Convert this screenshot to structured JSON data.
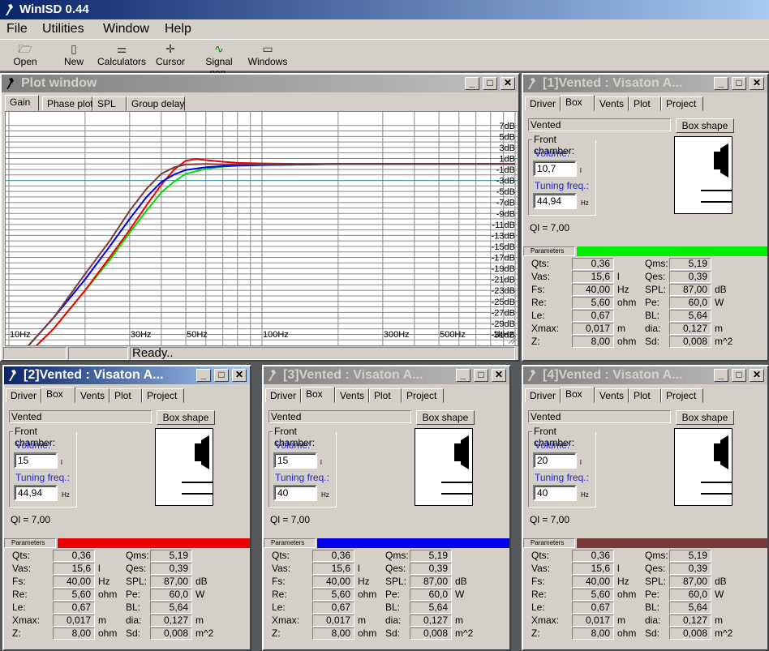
{
  "app": {
    "title": "WinISD 0.44"
  },
  "menu": [
    "File",
    "Utilities",
    "Window",
    "Help"
  ],
  "toolbar": [
    {
      "label": "Open",
      "icon": "open-folder-icon"
    },
    {
      "label": "New",
      "icon": "new-document-icon"
    },
    {
      "label": "Calculators",
      "icon": "calculator-icon"
    },
    {
      "label": "Cursor",
      "icon": "crosshair-cursor-icon"
    },
    {
      "label": "Signal gen.",
      "icon": "signal-generator-icon"
    },
    {
      "label": "Windows",
      "icon": "windows-icon"
    }
  ],
  "plot": {
    "title": "Plot window",
    "tabs": [
      "Gain",
      "Phase plot",
      "SPL",
      "Group delay"
    ],
    "status": "Ready..",
    "chart_data": {
      "type": "line",
      "x_scale": "log",
      "xlim": [
        10,
        1000
      ],
      "ylim": [
        -33,
        8
      ],
      "x_ticks": [
        {
          "v": 10,
          "t": "10Hz"
        },
        {
          "v": 30,
          "t": "30Hz"
        },
        {
          "v": 50,
          "t": "50Hz"
        },
        {
          "v": 100,
          "t": "100Hz"
        },
        {
          "v": 300,
          "t": "300Hz"
        },
        {
          "v": 500,
          "t": "500Hz"
        },
        {
          "v": 1000,
          "t": "1kHz"
        }
      ],
      "y_ticks": [
        {
          "v": 7,
          "t": "7dB"
        },
        {
          "v": 5,
          "t": "5dB"
        },
        {
          "v": 3,
          "t": "3dB"
        },
        {
          "v": 1,
          "t": "1dB"
        },
        {
          "v": -1,
          "t": "-1dB"
        },
        {
          "v": -3,
          "t": "-3dB"
        },
        {
          "v": -5,
          "t": "-5dB"
        },
        {
          "v": -7,
          "t": "-7dB"
        },
        {
          "v": -9,
          "t": "-9dB"
        },
        {
          "v": -11,
          "t": "-11dB"
        },
        {
          "v": -13,
          "t": "-13dB"
        },
        {
          "v": -15,
          "t": "-15dB"
        },
        {
          "v": -17,
          "t": "-17dB"
        },
        {
          "v": -19,
          "t": "-19dB"
        },
        {
          "v": -21,
          "t": "-21dB"
        },
        {
          "v": -23,
          "t": "-23dB"
        },
        {
          "v": -25,
          "t": "-25dB"
        },
        {
          "v": -27,
          "t": "-27dB"
        },
        {
          "v": -29,
          "t": "-29dB"
        },
        {
          "v": -31,
          "t": "-31dB"
        }
      ],
      "series": [
        {
          "color": "#00dd00",
          "x": [
            10,
            15,
            20,
            25,
            30,
            35,
            40,
            45,
            50,
            60,
            70,
            80,
            100,
            150,
            200,
            300,
            500,
            1000
          ],
          "y": [
            -38,
            -30,
            -23,
            -17.5,
            -12.5,
            -8.5,
            -5.2,
            -3.2,
            -1.8,
            -0.9,
            -0.5,
            -0.3,
            -0.2,
            -0.1,
            0,
            0,
            0,
            0
          ]
        },
        {
          "color": "#ee0000",
          "x": [
            10,
            15,
            20,
            25,
            30,
            35,
            40,
            45,
            50,
            55,
            60,
            70,
            80,
            100,
            150,
            200,
            300,
            500,
            1000
          ],
          "y": [
            -38,
            -30,
            -23,
            -17,
            -12,
            -7.5,
            -3.8,
            -1,
            0.6,
            0.9,
            0.7,
            0.4,
            0.2,
            0.1,
            0,
            0,
            0,
            0,
            0
          ]
        },
        {
          "color": "#0000ee",
          "x": [
            10,
            15,
            20,
            25,
            30,
            35,
            40,
            45,
            50,
            60,
            70,
            80,
            100,
            150,
            200,
            300,
            500,
            1000
          ],
          "y": [
            -37,
            -28,
            -21,
            -15,
            -10,
            -6,
            -3.3,
            -1.9,
            -1.1,
            -0.6,
            -0.4,
            -0.3,
            -0.2,
            -0.1,
            0,
            0,
            0,
            0
          ]
        },
        {
          "color": "#7a3a3a",
          "x": [
            10,
            15,
            20,
            25,
            30,
            35,
            40,
            45,
            50,
            60,
            70,
            80,
            100,
            150,
            200,
            300,
            500,
            1000
          ],
          "y": [
            -37,
            -28,
            -20,
            -14,
            -8.5,
            -4.5,
            -1.8,
            -0.6,
            -0.1,
            0,
            -0.1,
            -0.1,
            -0.1,
            0,
            0,
            0,
            0,
            0
          ]
        }
      ]
    }
  },
  "drivers": [
    {
      "id": "1",
      "title": "[1]Vented : Visaton A...",
      "active": false,
      "tabs": [
        "Driver",
        "Box",
        "Vents",
        "Plot",
        "Project"
      ],
      "box_type": "Vented",
      "box_shape_btn": "Box shape",
      "front_chamber": "Front chamber:",
      "volume_label": "Volume:",
      "volume": "10,7",
      "volume_unit": "l",
      "tuning_label": "Tuning freq.:",
      "tuning": "44,94",
      "tuning_unit": "Hz",
      "ql": "Ql = 7,00",
      "parameters_label": "Parameters",
      "color": "#00ee00"
    },
    {
      "id": "2",
      "title": "[2]Vented : Visaton A...",
      "active": true,
      "tabs": [
        "Driver",
        "Box",
        "Vents",
        "Plot",
        "Project"
      ],
      "box_type": "Vented",
      "box_shape_btn": "Box shape",
      "front_chamber": "Front chamber:",
      "volume_label": "Volume:",
      "volume": "15",
      "volume_unit": "l",
      "tuning_label": "Tuning freq.:",
      "tuning": "44,94",
      "tuning_unit": "Hz",
      "ql": "Ql = 7,00",
      "parameters_label": "Parameters",
      "color": "#ee0000"
    },
    {
      "id": "3",
      "title": "[3]Vented : Visaton A...",
      "active": false,
      "tabs": [
        "Driver",
        "Box",
        "Vents",
        "Plot",
        "Project"
      ],
      "box_type": "Vented",
      "box_shape_btn": "Box shape",
      "front_chamber": "Front chamber:",
      "volume_label": "Volume:",
      "volume": "15",
      "volume_unit": "l",
      "tuning_label": "Tuning freq.:",
      "tuning": "40",
      "tuning_unit": "Hz",
      "ql": "Ql = 7,00",
      "parameters_label": "Parameters",
      "color": "#0000ee"
    },
    {
      "id": "4",
      "title": "[4]Vented : Visaton A...",
      "active": false,
      "tabs": [
        "Driver",
        "Box",
        "Vents",
        "Plot",
        "Project"
      ],
      "box_type": "Vented",
      "box_shape_btn": "Box shape",
      "front_chamber": "Front chamber:",
      "volume_label": "Volume:",
      "volume": "20",
      "volume_unit": "l",
      "tuning_label": "Tuning freq.:",
      "tuning": "40",
      "tuning_unit": "Hz",
      "ql": "Ql = 7,00",
      "parameters_label": "Parameters",
      "color": "#7a3a3a"
    }
  ],
  "params_left": [
    {
      "label": "Qts:",
      "value": "0,36",
      "unit": ""
    },
    {
      "label": "Vas:",
      "value": "15,6",
      "unit": "l"
    },
    {
      "label": "Fs:",
      "value": "40,00",
      "unit": "Hz"
    },
    {
      "label": "Re:",
      "value": "5,60",
      "unit": "ohm"
    },
    {
      "label": "Le:",
      "value": "0,67",
      "unit": ""
    },
    {
      "label": "Xmax:",
      "value": "0,017",
      "unit": "m"
    },
    {
      "label": "Z:",
      "value": "8,00",
      "unit": "ohm"
    }
  ],
  "params_right": [
    {
      "label": "Qms:",
      "value": "5,19",
      "unit": ""
    },
    {
      "label": "Qes:",
      "value": "0,39",
      "unit": ""
    },
    {
      "label": "SPL:",
      "value": "87,00",
      "unit": "dB"
    },
    {
      "label": "Pe:",
      "value": "60,0",
      "unit": "W"
    },
    {
      "label": "BL:",
      "value": "5,64",
      "unit": ""
    },
    {
      "label": "dia:",
      "value": "0,127",
      "unit": "m"
    },
    {
      "label": "Sd:",
      "value": "0,008",
      "unit": "m^2"
    }
  ]
}
